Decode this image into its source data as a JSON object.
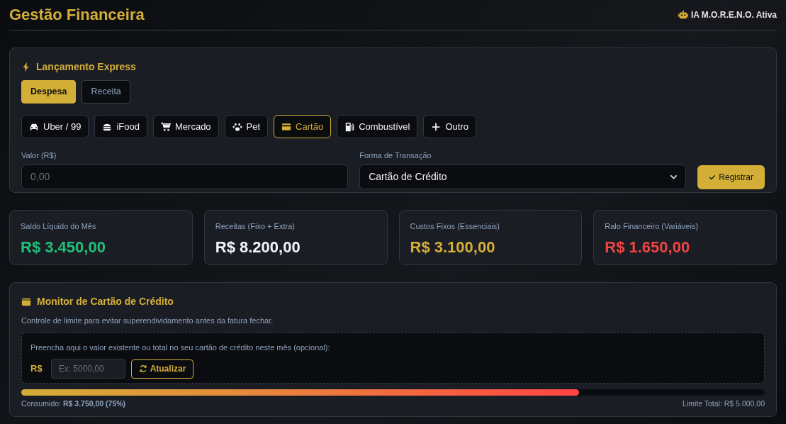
{
  "header": {
    "title": "Gestão Financeira",
    "status": "IA M.O.R.E.N.O. Ativa"
  },
  "express": {
    "title": "Lançamento Express",
    "types": [
      {
        "label": "Despesa",
        "selected": true
      },
      {
        "label": "Receita",
        "selected": false
      }
    ],
    "categories": [
      {
        "label": "Uber / 99",
        "selected": false
      },
      {
        "label": "iFood",
        "selected": false
      },
      {
        "label": "Mercado",
        "selected": false
      },
      {
        "label": "Pet",
        "selected": false
      },
      {
        "label": "Cartão",
        "selected": true
      },
      {
        "label": "Combustível",
        "selected": false
      },
      {
        "label": "Outro",
        "selected": false
      }
    ],
    "amount": {
      "label": "Valor (R$)",
      "placeholder": "0,00"
    },
    "method": {
      "label": "Forma de Transação",
      "value": "Cartão de Crédito"
    },
    "submit": "Registrar"
  },
  "stats": [
    {
      "label": "Saldo Líquido do Mês",
      "value": "R$ 3.450,00",
      "color": "#20c07a"
    },
    {
      "label": "Receitas (Fixo + Extra)",
      "value": "R$ 8.200,00",
      "color": "#f2f4f7"
    },
    {
      "label": "Custos Fixos (Essenciais)",
      "value": "R$ 3.100,00",
      "color": "#d4af37"
    },
    {
      "label": "Ralo Financeiro (Variáveis)",
      "value": "R$ 1.650,00",
      "color": "#f04444"
    }
  ],
  "monitor": {
    "title": "Monitor de Cartão de Crédito",
    "subtitle": "Controle de limite para evitar superendividamento antes da fatura fechar.",
    "prompt": "Preencha aqui o valor existente ou total no seu cartão de crédito neste mês (opcional):",
    "currency": "R$",
    "placeholder": "Ex: 5000,00",
    "button": "Atualizar",
    "level": 0.75,
    "consumed_label": "Consumido:",
    "consumed_value": "R$ 3.750,00 (75%)",
    "limit": "Limite Total: R$ 5.000,00"
  }
}
